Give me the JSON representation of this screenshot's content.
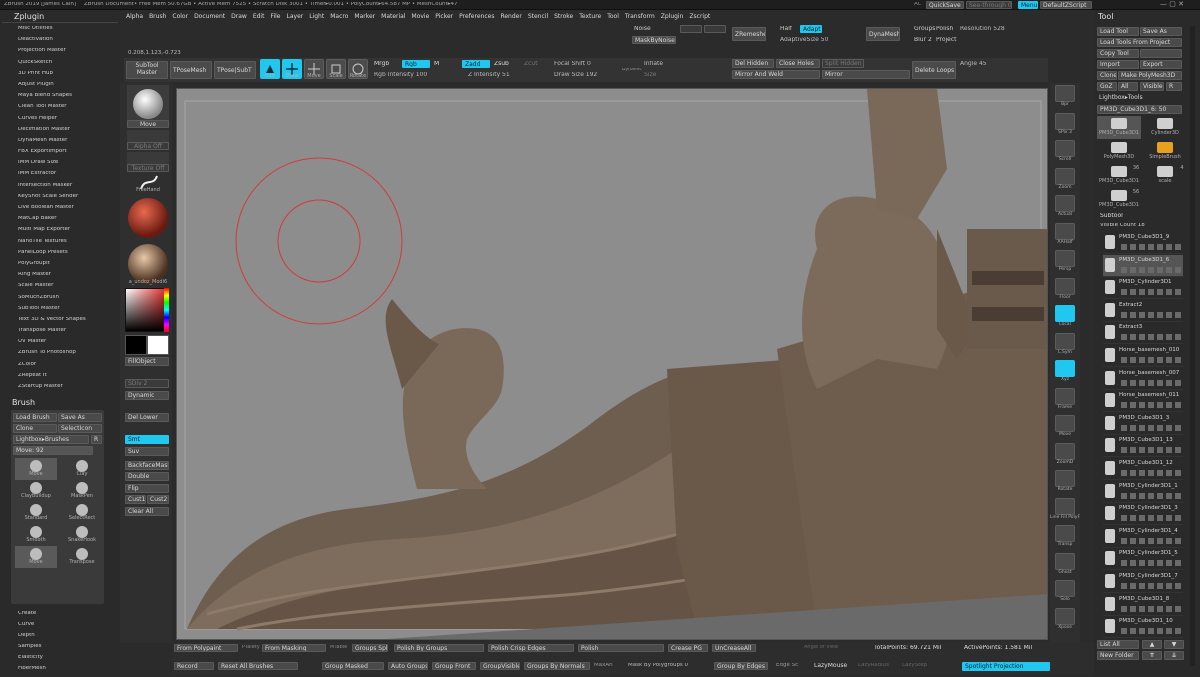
{
  "titlebar": {
    "title": "ZBrush 2019 [James Cain]",
    "document": "ZBrush Document",
    "stats": "• Free Mem 50.67GB • Active Mem 7525 • Scratch Disk 3001 • Timer▸0.001 • PolyCount▸64.587 MP • MeshCount▸47",
    "ac": "AC",
    "quicksave": "QuickSave",
    "seethrough": "See-through 0",
    "menus": "Menus",
    "defaultscript": "DefaultZScript"
  },
  "menubar": [
    "Alpha",
    "Brush",
    "Color",
    "Document",
    "Draw",
    "Edit",
    "File",
    "Layer",
    "Light",
    "Macro",
    "Marker",
    "Material",
    "Movie",
    "Picker",
    "Preferences",
    "Render",
    "Stencil",
    "Stroke",
    "Texture",
    "Tool",
    "Transform",
    "Zplugin",
    "Zscript"
  ],
  "coords": "0.208,1.123,-0.723",
  "zplugin": {
    "title": "Zplugin",
    "items": [
      "Misc Utilities",
      "Deactivation",
      "Projection Master",
      "QuickSketch",
      "3D Print Hub",
      "Adjust Plugin",
      "Maya Blend Shapes",
      "Clean Tool Master",
      "Curves Helper",
      "Decimation Master",
      "DynaMesh Master",
      "FBX ExportImport",
      "IMM Draw Size",
      "IMM Extractor",
      "Intersection Masker",
      "KeyShot Scale Sender",
      "Live Boolean Master",
      "MatCap Baker",
      "Multi Map Exporter",
      "NanoTile Textures",
      "PanelLoop Presets",
      "PolyGroupIt",
      "Ring Master",
      "Scale Master",
      "SoMuchZbrush",
      "SubTool Master",
      "Text 3D & Vector Shapes",
      "Transpose Master",
      "UV Master",
      "ZBrush To Photoshop",
      "ZColor",
      "ZRepeat It",
      "ZStartup Master"
    ]
  },
  "brushpanel": {
    "title": "Brush",
    "load": "Load Brush",
    "saveas": "Save As",
    "clone": "Clone",
    "selecticon": "SelectIcon",
    "lightbox": "Lightbox▸Brushes",
    "move_label": "Move: 92",
    "brushes": [
      "Move",
      "Clay",
      "ClayBuildup",
      "MaskPen",
      "Standard",
      "SelectRect",
      "Smooth",
      "SnakeHook",
      "Move",
      "Transpose"
    ]
  },
  "bottomleft": [
    "Create",
    "Curve",
    "Depth",
    "Samples",
    "Elasticity",
    "FiberMesh"
  ],
  "shelf": {
    "move": "Move",
    "alpha_off": "Alpha Off",
    "texture_off": "Texture Off",
    "freehand": "FreeHand",
    "material": "a_undoz_Modi6",
    "fillobject": "FillObject",
    "sdiv": "SDiv 2",
    "dynamic": "Dynamic",
    "del_lower": "Del Lower",
    "smt": "Smt",
    "suv": "Suv",
    "backfacemask": "BackfaceMask",
    "double": "Double",
    "flip": "Flip",
    "cust1": "Cust1",
    "cust2": "Cust2",
    "clear_all": "Clear All"
  },
  "toptoolbar": {
    "subtool_master": "SubTool Master",
    "tposemesh": "TPoseMesh",
    "tposesubt": "TPose|SubT",
    "edit": "Edit",
    "draw": "Draw",
    "move": "Move",
    "scale": "Scale",
    "rotate": "Rotate",
    "mrgb": "Mrgb",
    "rgb": "Rgb",
    "m": "M",
    "rgb_intensity": "Rgb Intensity 100",
    "zadd": "Zadd",
    "zsub": "Zsub",
    "zcut": "Zcut",
    "z_intensity": "Z Intensity 51",
    "focal_shift": "Focal Shift 0",
    "draw_size": "Draw Size 192",
    "dynamic": "Dynamic",
    "inflate": "Inflate",
    "size": "Size",
    "del_hidden": "Del Hidden",
    "close_holes": "Close Holes",
    "split_hidden": "Split Hidden",
    "mirror_weld": "Mirror And Weld",
    "mirror": "Mirror",
    "delete_loops": "Delete Loops",
    "angle": "Angle 45",
    "noise": "Noise",
    "mask_by_noise": "MaskByNoise",
    "zremesher": "ZRemesher",
    "half": "Half",
    "adapt": "Adapt",
    "adaptive_size": "AdaptiveSize 50",
    "dynamesh": "DynaMesh",
    "groups": "Groups",
    "polish": "Polish",
    "blur": "Blur 2",
    "project": "Project",
    "resolution": "Resolution 528"
  },
  "rightshelf": [
    "Bpr",
    "SPix 3",
    "Scroll",
    "Zoom",
    "Actual",
    "AAHalf",
    "Persp",
    "Floor",
    "Local",
    "L.Sym",
    "Xyz",
    "Frame",
    "Move",
    "ZoomD",
    "Rotate",
    "Line Fill PolyF",
    "Transp",
    "Ghost",
    "Solo",
    "Xpose"
  ],
  "bottombar": {
    "from_polypaint": "From Polypaint",
    "polygroups": "PTalety",
    "from_masking": "From Masking",
    "mtable": "MTable",
    "groups_split": "Groups Split",
    "polish_by_groups": "Polish By Groups",
    "polish_crisp": "Polish Crisp Edges",
    "polish": "Polish",
    "crease_pg": "Crease PG",
    "uncrease_all": "UnCreaseAll",
    "angle_of_view": "Angle of View",
    "total_points": "TotalPoints: 69.721 Mil",
    "active_points": "ActivePoints: 1.581 Mil",
    "record": "Record",
    "reset_all_brushes": "Reset All Brushes",
    "group_masked": "Group Masked",
    "auto_groups": "Auto Groups",
    "group_front": "Group Front",
    "group_visible": "GroupVisible",
    "groups_by_normals": "Groups By Normals",
    "max_angle": "MaxAn",
    "mask_by_polygroups": "Mask By Polygroups 0",
    "group_by_edges": "Group By Edges",
    "edge_s": "Edge Sc",
    "lazymouse": "LazyMouse",
    "lazy_radius": "LazyRadius",
    "lazy_step": "LazyStep",
    "spotlight_projection": "Spotlight Projection"
  },
  "toolpanel": {
    "title": "Tool",
    "load_tool": "Load Tool",
    "save_as": "Save As",
    "load_from_project": "Load Tools From Project",
    "copy_tool": "Copy Tool",
    "import": "Import",
    "export": "Export",
    "clone": "Clone",
    "make_polymesh": "Make PolyMesh3D",
    "goz": "GoZ",
    "all": "All",
    "visible": "Visible",
    "r": "R",
    "lightbox_tools": "Lightbox▸Tools",
    "current_tool": "PM3D_Cube3D1_6: 50",
    "tools": [
      {
        "name": "PM3D_Cube3D1",
        "count": ""
      },
      {
        "name": "Cylinder3D",
        "count": ""
      },
      {
        "name": "PolyMesh3D",
        "count": ""
      },
      {
        "name": "SimpleBrush",
        "count": ""
      },
      {
        "name": "PM3D_Cube3D1",
        "count": "36"
      },
      {
        "name": "scale",
        "count": "4"
      },
      {
        "name": "PM3D_Cube3D1",
        "count": "56"
      }
    ],
    "subtool_title": "Subtool",
    "visible_count": "Visible Count 18",
    "subtools": [
      "PM3D_Cube3D1_9",
      "PM3D_Cube3D1_6",
      "PM3D_Cylinder3D1",
      "Extract2",
      "Extract3",
      "Horse_basemesh_010",
      "Horse_basemesh_007",
      "Horse_basemesh_011",
      "PM3D_Cube3D1_3",
      "PM3D_Cube3D1_13",
      "PM3D_Cube3D1_12",
      "PM3D_Cylinder3D1_1",
      "PM3D_Cylinder3D1_3",
      "PM3D_Cylinder3D1_4",
      "PM3D_Cylinder3D1_5",
      "PM3D_Cylinder3D1_7",
      "PM3D_Cube3D1_8",
      "PM3D_Cube3D1_10"
    ],
    "list_all": "List All",
    "new_folder": "New Folder"
  },
  "colors": {
    "accent": "#20c8f0",
    "canvas": "#8d8d8d",
    "panel": "#2b2b2b",
    "brush_ring": "#d23a3a",
    "sculpt": "#7b6a5a"
  }
}
